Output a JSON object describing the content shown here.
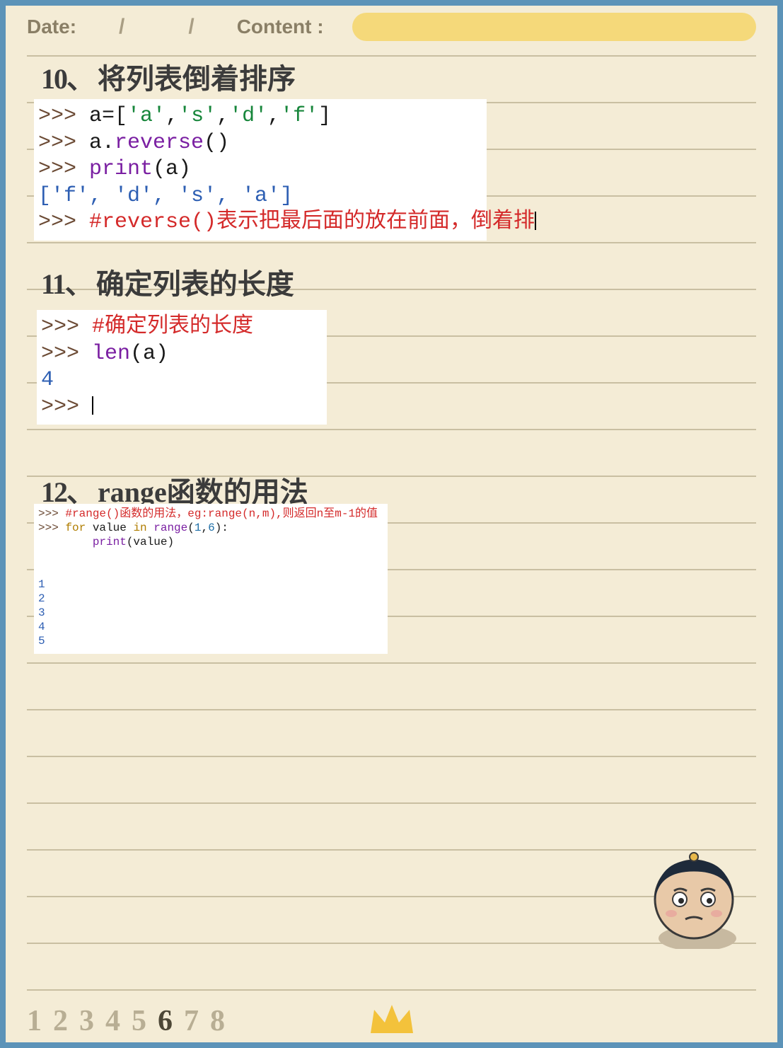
{
  "header": {
    "date_label": "Date:",
    "content_label": "Content :",
    "slash": "/"
  },
  "sections": {
    "s10": {
      "num": "10、",
      "title": "将列表倒着排序"
    },
    "s11": {
      "num": "11、",
      "title": "确定列表的长度"
    },
    "s12": {
      "num": "12、",
      "title": "range函数的用法"
    }
  },
  "code1": {
    "l1_prompt": ">>> ",
    "l1_a": "a=[",
    "l1_s1": "'a'",
    "l1_c": ",",
    "l1_s2": "'s'",
    "l1_s3": "'d'",
    "l1_s4": "'f'",
    "l1_b": "]",
    "l2_prompt": ">>> ",
    "l2_a": "a.",
    "l2_fn": "reverse",
    "l2_p": "()",
    "l3_prompt": ">>> ",
    "l3_fn": "print",
    "l3_p": "(a)",
    "l4": "['f', 'd', 's', 'a']",
    "l5_prompt": ">>> ",
    "l5_c": "#reverse()表示把最后面的放在前面，倒着排"
  },
  "code2": {
    "l1_prompt": ">>> ",
    "l1_c": "#确定列表的长度",
    "l2_prompt": ">>> ",
    "l2_fn": "len",
    "l2_p": "(a)",
    "l3": "4",
    "l4_prompt": ">>> "
  },
  "code3": {
    "l1_prompt": ">>> ",
    "l1_c": "#range()函数的用法，eg:range(n,m),则返回n至m-1的值",
    "l2_prompt": ">>> ",
    "l2_for": "for",
    "l2_v": " value ",
    "l2_in": "in",
    "l2_sp": " ",
    "l2_fn": "range",
    "l2_op": "(",
    "l2_n1": "1",
    "l2_cm": ",",
    "l2_n2": "6",
    "l2_cp": "):",
    "l3_indent": "        ",
    "l3_fn": "print",
    "l3_p": "(value)",
    "out1": "1",
    "out2": "2",
    "out3": "3",
    "out4": "4",
    "out5": "5"
  },
  "footer": {
    "p1": "1",
    "p2": "2",
    "p3": "3",
    "p4": "4",
    "p5": "5",
    "p6": "6",
    "p7": "7",
    "p8": "8",
    "current": 6
  }
}
